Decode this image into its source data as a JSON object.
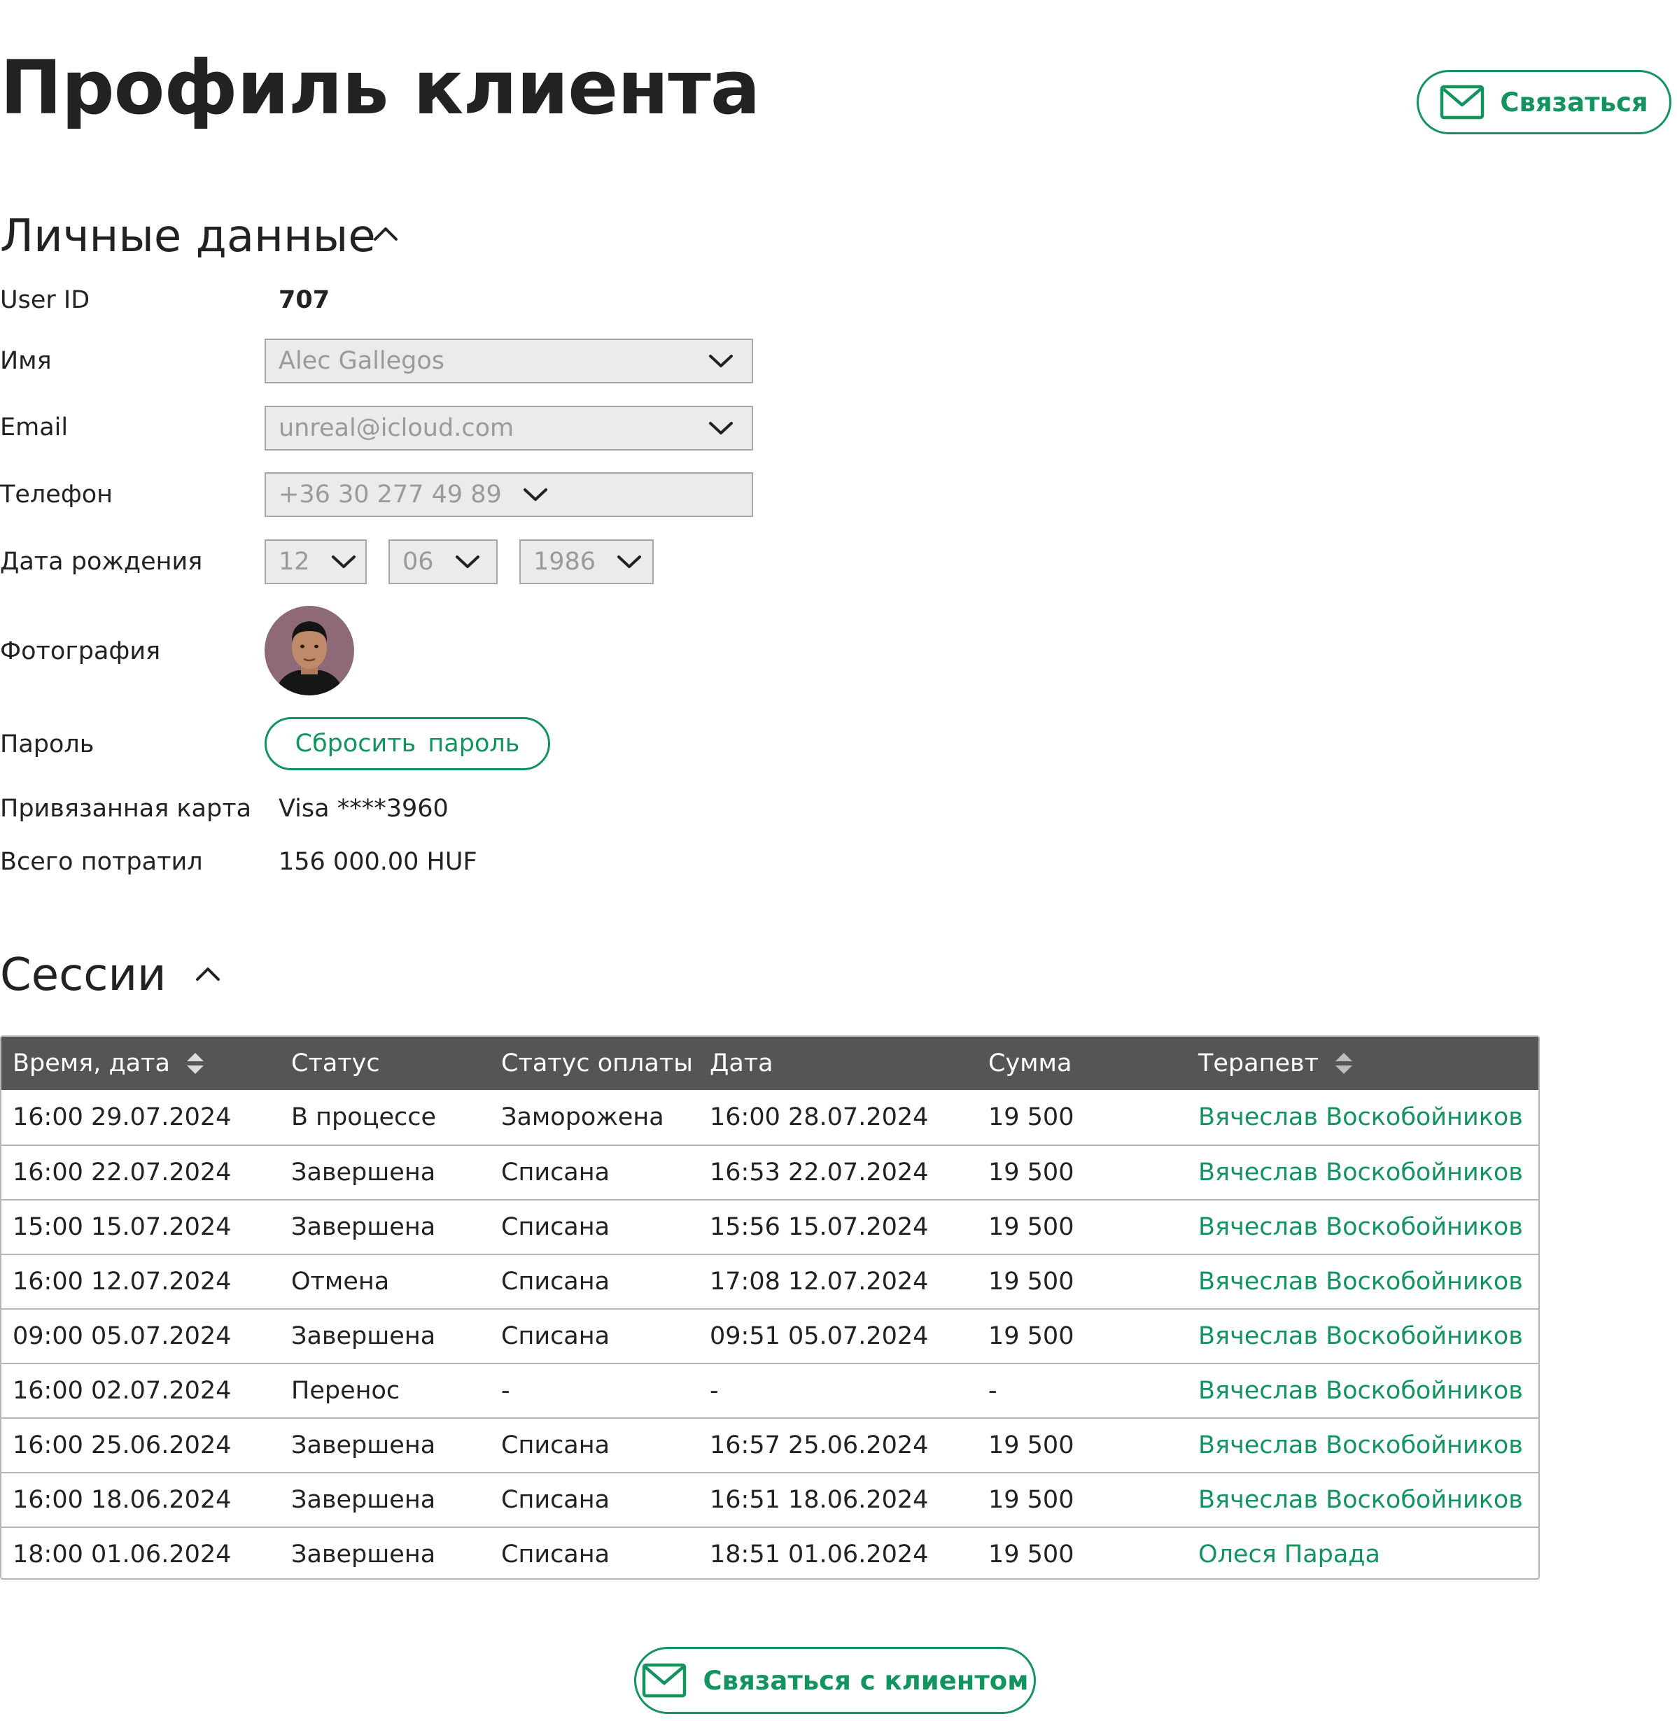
{
  "header": {
    "title": "Профиль клиента",
    "contact_label": "Связаться"
  },
  "personal": {
    "title": "Личные данные",
    "user_id_label": "User ID",
    "user_id": "707",
    "name_label": "Имя",
    "name_value": "Alec Gallegos",
    "email_label": "Email",
    "email_value": "unreal@icloud.com",
    "phone_label": "Телефон",
    "phone_value": "+36 30 277 49 89",
    "birth_label": "Дата рождения",
    "birth_day": "12",
    "birth_month": "06",
    "birth_year": "1986",
    "photo_label": "Фотография",
    "password_label": "Пароль",
    "reset_password_label": "Сбросить  пароль",
    "card_label": "Привязанная карта",
    "card_value": "Visa ****3960",
    "spent_label": "Всего потратил",
    "spent_value": "156 000.00 HUF"
  },
  "sessions": {
    "title": "Сессии",
    "columns": [
      "Время, дата",
      "Статус",
      "Статус оплаты",
      "Дата",
      "Сумма",
      "Терапевт"
    ],
    "rows": [
      {
        "time": "16:00  29.07.2024",
        "status": "В процессе",
        "payment": "Заморожена",
        "date": "16:00 28.07.2024",
        "sum": "19 500",
        "therapist": "Вячеслав Воскобойников"
      },
      {
        "time": "16:00  22.07.2024",
        "status": "Завершена",
        "payment": "Списана",
        "date": "16:53 22.07.2024",
        "sum": "19 500",
        "therapist": "Вячеслав Воскобойников"
      },
      {
        "time": "15:00  15.07.2024",
        "status": "Завершена",
        "payment": "Списана",
        "date": "15:56 15.07.2024",
        "sum": "19 500",
        "therapist": "Вячеслав Воскобойников"
      },
      {
        "time": "16:00  12.07.2024",
        "status": "Отмена",
        "payment": "Списана",
        "date": "17:08 12.07.2024",
        "sum": "19 500",
        "therapist": "Вячеслав Воскобойников"
      },
      {
        "time": "09:00  05.07.2024",
        "status": "Завершена",
        "payment": "Списана",
        "date": "09:51 05.07.2024",
        "sum": "19 500",
        "therapist": "Вячеслав Воскобойников"
      },
      {
        "time": "16:00  02.07.2024",
        "status": "Перенос",
        "payment": "-",
        "date": "-",
        "sum": "-",
        "therapist": "Вячеслав Воскобойников"
      },
      {
        "time": "16:00  25.06.2024",
        "status": "Завершена",
        "payment": "Списана",
        "date": "16:57 25.06.2024",
        "sum": "19 500",
        "therapist": "Вячеслав Воскобойников"
      },
      {
        "time": "16:00  18.06.2024",
        "status": "Завершена",
        "payment": "Списана",
        "date": "16:51 18.06.2024",
        "sum": "19 500",
        "therapist": "Вячеслав Воскобойников"
      },
      {
        "time": "18:00  01.06.2024",
        "status": "Завершена",
        "payment": "Списана",
        "date": "18:51 01.06.2024",
        "sum": "19 500",
        "therapist": "Олеся Парада"
      }
    ]
  },
  "footer": {
    "contact_client_label": "Связаться с клиентом"
  },
  "colors": {
    "accent": "#13945f",
    "table_header": "#555555",
    "input_bg": "#ebebeb"
  }
}
